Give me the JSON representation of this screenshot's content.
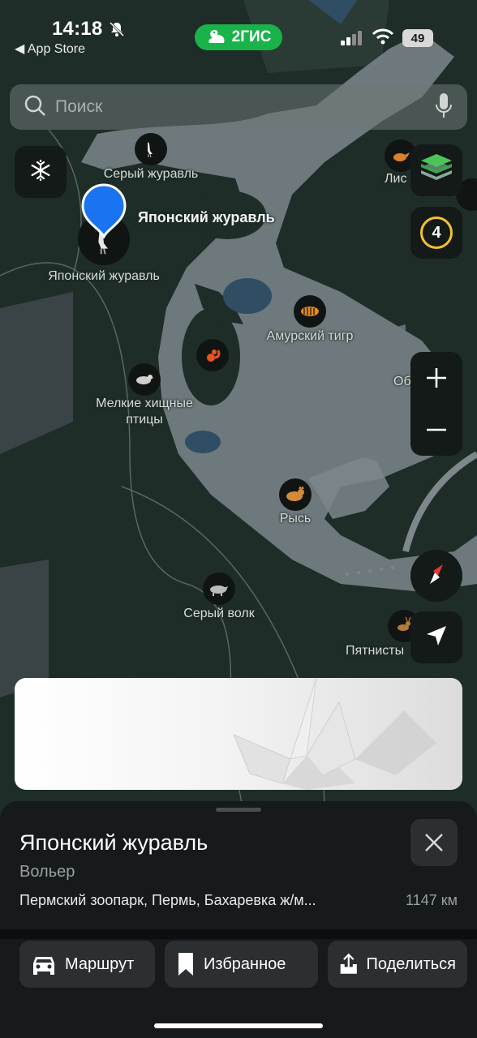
{
  "status_bar": {
    "time": "14:18",
    "back_label": "◀ App Store",
    "battery": "49"
  },
  "brand": {
    "name": "2ГИС",
    "color": "#19b34a"
  },
  "search": {
    "placeholder": "Поиск"
  },
  "controls": {
    "layers_count": "4"
  },
  "map": {
    "selected_label": "Японский журавль",
    "labels": {
      "grey_crane": "Серый журавль",
      "japanese_crane": "Японский журавль",
      "amur_tiger": "Амурский тигр",
      "small_raptors": "Мелкие хищные\nптицы",
      "lynx": "Рысь",
      "grey_wolf": "Серый волк",
      "fox": "Лис",
      "obl": "Об",
      "spotted": "Пятнисты"
    }
  },
  "place": {
    "title": "Японский журавль",
    "type": "Вольер",
    "address": "Пермский зоопарк, Пермь, Бахаревка ж/м...",
    "distance": "1147 км"
  },
  "actions": {
    "route": "Маршрут",
    "favorites": "Избранное",
    "share": "Поделиться"
  },
  "colors": {
    "accent_blue": "#1a73f0",
    "map_bg": "#1e2b27",
    "path": "#8a9396"
  }
}
